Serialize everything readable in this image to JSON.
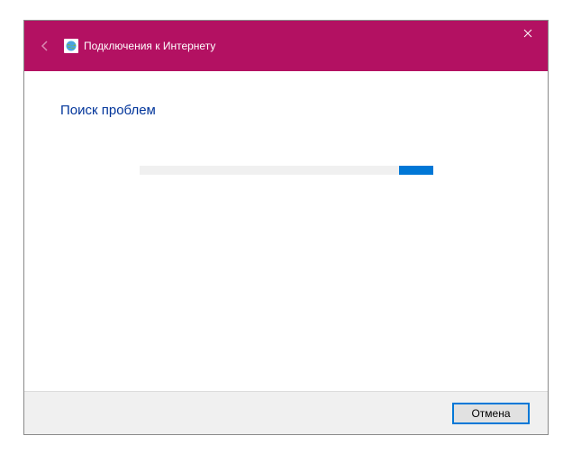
{
  "titlebar": {
    "title": "Подключения к Интернету"
  },
  "content": {
    "heading": "Поиск проблем"
  },
  "footer": {
    "cancel_label": "Отмена"
  },
  "colors": {
    "accent": "#b31162",
    "link": "#00349a",
    "progress": "#0077d6"
  }
}
